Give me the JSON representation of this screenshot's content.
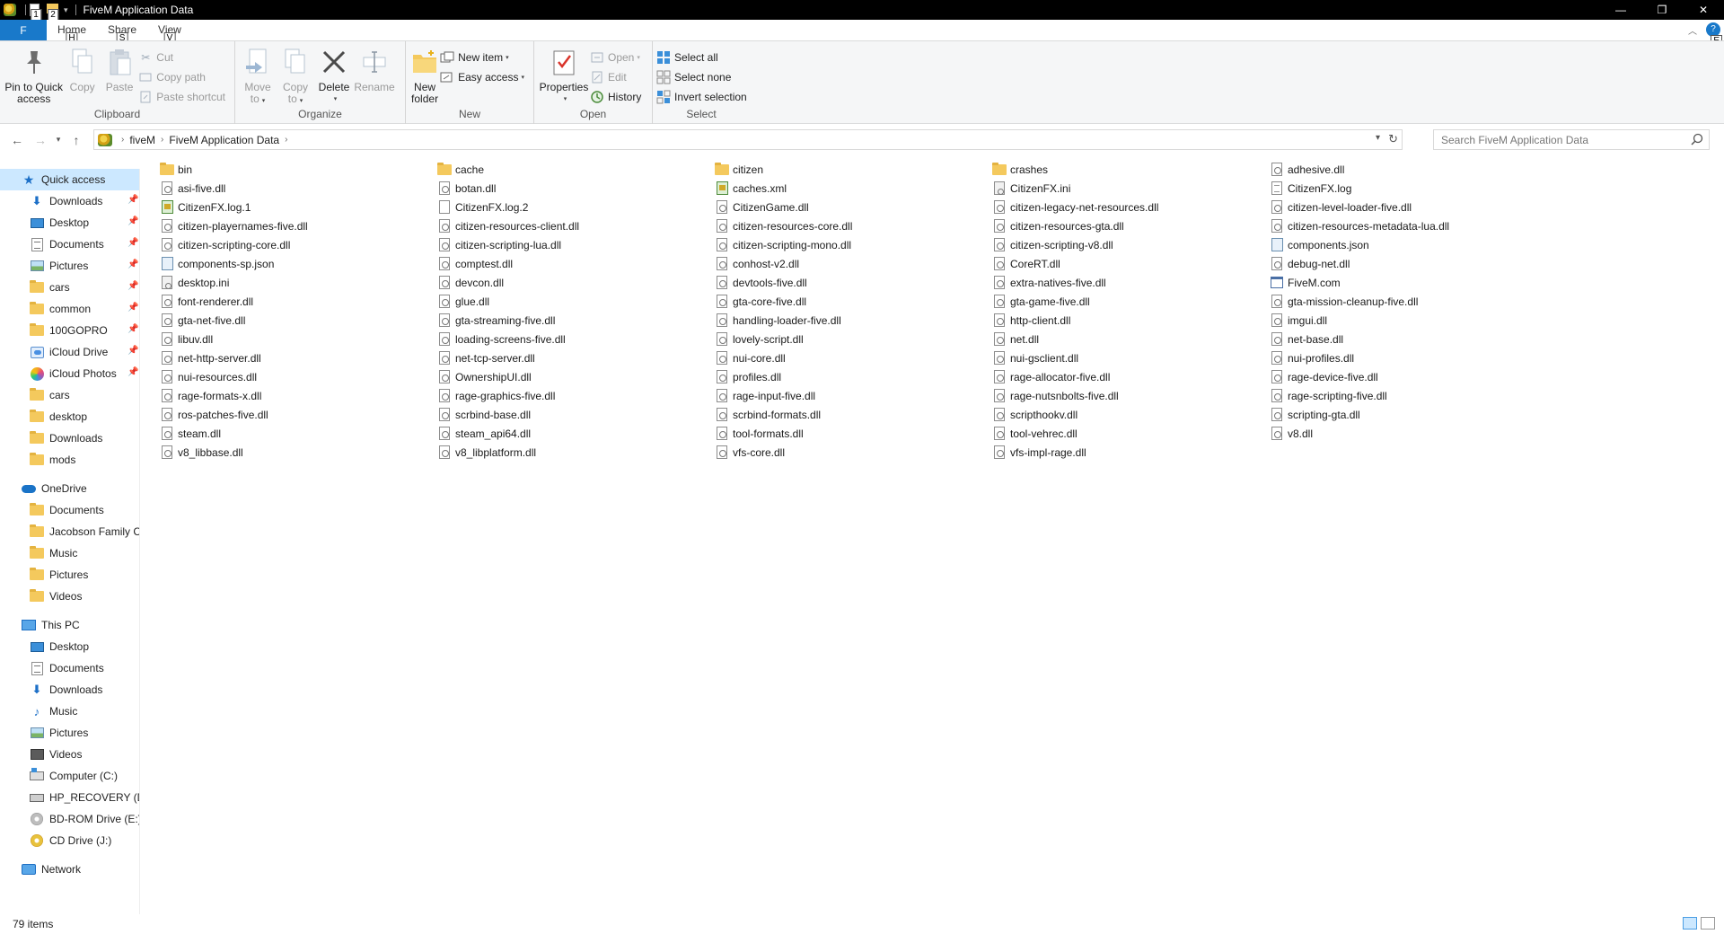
{
  "window": {
    "title": "FiveM Application Data",
    "controls": [
      "minimize",
      "maximize",
      "close"
    ]
  },
  "quick_access_toolbar": {
    "keytips": [
      "1",
      "2"
    ]
  },
  "ribbon_tabs": {
    "file": {
      "label": "F"
    },
    "tabs": [
      {
        "label": "Home",
        "keytip": "H"
      },
      {
        "label": "Share",
        "keytip": "S"
      },
      {
        "label": "View",
        "keytip": "V"
      }
    ],
    "help_keytip": "E"
  },
  "ribbon": {
    "clipboard": {
      "label": "Clipboard",
      "pin": "Pin to Quick access",
      "pin_line1": "Pin to Quick",
      "pin_line2": "access",
      "copy": "Copy",
      "paste": "Paste",
      "cut": "Cut",
      "copy_path": "Copy path",
      "paste_shortcut": "Paste shortcut"
    },
    "organize": {
      "label": "Organize",
      "move_to": "Move",
      "move_to2": "to",
      "copy_to": "Copy",
      "copy_to2": "to",
      "delete": "Delete",
      "rename": "Rename"
    },
    "new": {
      "label": "New",
      "new_folder1": "New",
      "new_folder2": "folder",
      "new_item": "New item",
      "easy_access": "Easy access"
    },
    "open": {
      "label": "Open",
      "properties": "Properties",
      "open": "Open",
      "edit": "Edit",
      "history": "History"
    },
    "select": {
      "label": "Select",
      "select_all": "Select all",
      "select_none": "Select none",
      "invert_selection": "Invert selection"
    }
  },
  "address": {
    "crumbs": [
      "fiveM",
      "FiveM Application Data"
    ],
    "search_placeholder": "Search FiveM Application Data"
  },
  "sidebar": {
    "quick_access": {
      "label": "Quick access"
    },
    "quick_items": [
      {
        "label": "Downloads",
        "icon": "download-icon",
        "pinned": true
      },
      {
        "label": "Desktop",
        "icon": "desktop-icon",
        "pinned": true
      },
      {
        "label": "Documents",
        "icon": "documents-icon",
        "pinned": true
      },
      {
        "label": "Pictures",
        "icon": "pictures-icon",
        "pinned": true
      },
      {
        "label": "cars",
        "icon": "folder-icon",
        "pinned": true
      },
      {
        "label": "common",
        "icon": "folder-icon",
        "pinned": true
      },
      {
        "label": "100GOPRO",
        "icon": "folder-icon",
        "pinned": true
      },
      {
        "label": "iCloud Drive",
        "icon": "icloud-drive-icon",
        "pinned": true
      },
      {
        "label": "iCloud Photos",
        "icon": "icloud-photos-icon",
        "pinned": true
      },
      {
        "label": "cars",
        "icon": "folder-icon",
        "pinned": false
      },
      {
        "label": "desktop",
        "icon": "folder-icon",
        "pinned": false
      },
      {
        "label": "Downloads",
        "icon": "folder-icon",
        "pinned": false
      },
      {
        "label": "mods",
        "icon": "folder-icon",
        "pinned": false
      }
    ],
    "onedrive": {
      "label": "OneDrive"
    },
    "onedrive_items": [
      {
        "label": "Documents",
        "icon": "folder-icon"
      },
      {
        "label": "Jacobson Family Cc",
        "icon": "folder-icon"
      },
      {
        "label": "Music",
        "icon": "folder-icon"
      },
      {
        "label": "Pictures",
        "icon": "folder-icon"
      },
      {
        "label": "Videos",
        "icon": "folder-icon"
      }
    ],
    "this_pc": {
      "label": "This PC"
    },
    "pc_items": [
      {
        "label": "Desktop",
        "icon": "desktop-icon"
      },
      {
        "label": "Documents",
        "icon": "documents-icon"
      },
      {
        "label": "Downloads",
        "icon": "download-icon"
      },
      {
        "label": "Music",
        "icon": "music-icon"
      },
      {
        "label": "Pictures",
        "icon": "pictures-icon"
      },
      {
        "label": "Videos",
        "icon": "videos-icon"
      },
      {
        "label": "Computer (C:)",
        "icon": "drive-c-icon"
      },
      {
        "label": "HP_RECOVERY (D:)",
        "icon": "drive-d-icon"
      },
      {
        "label": "BD-ROM Drive (E:) F",
        "icon": "bd-rom-icon"
      },
      {
        "label": "CD Drive (J:)",
        "icon": "cd-drive-icon"
      }
    ],
    "network": {
      "label": "Network"
    }
  },
  "files": [
    {
      "name": "bin",
      "type": "folder"
    },
    {
      "name": "cache",
      "type": "folder"
    },
    {
      "name": "citizen",
      "type": "folder"
    },
    {
      "name": "crashes",
      "type": "folder"
    },
    {
      "name": "adhesive.dll",
      "type": "dll"
    },
    {
      "name": "asi-five.dll",
      "type": "dll"
    },
    {
      "name": "botan.dll",
      "type": "dll"
    },
    {
      "name": "caches.xml",
      "type": "xml"
    },
    {
      "name": "CitizenFX.ini",
      "type": "ini"
    },
    {
      "name": "CitizenFX.log",
      "type": "log"
    },
    {
      "name": "CitizenFX.log.1",
      "type": "xml"
    },
    {
      "name": "CitizenFX.log.2",
      "type": "file"
    },
    {
      "name": "CitizenGame.dll",
      "type": "dll"
    },
    {
      "name": "citizen-legacy-net-resources.dll",
      "type": "dll"
    },
    {
      "name": "citizen-level-loader-five.dll",
      "type": "dll"
    },
    {
      "name": "citizen-playernames-five.dll",
      "type": "dll"
    },
    {
      "name": "citizen-resources-client.dll",
      "type": "dll"
    },
    {
      "name": "citizen-resources-core.dll",
      "type": "dll"
    },
    {
      "name": "citizen-resources-gta.dll",
      "type": "dll"
    },
    {
      "name": "citizen-resources-metadata-lua.dll",
      "type": "dll"
    },
    {
      "name": "citizen-scripting-core.dll",
      "type": "dll"
    },
    {
      "name": "citizen-scripting-lua.dll",
      "type": "dll"
    },
    {
      "name": "citizen-scripting-mono.dll",
      "type": "dll"
    },
    {
      "name": "citizen-scripting-v8.dll",
      "type": "dll"
    },
    {
      "name": "components.json",
      "type": "json"
    },
    {
      "name": "components-sp.json",
      "type": "json"
    },
    {
      "name": "comptest.dll",
      "type": "dll"
    },
    {
      "name": "conhost-v2.dll",
      "type": "dll"
    },
    {
      "name": "CoreRT.dll",
      "type": "dll"
    },
    {
      "name": "debug-net.dll",
      "type": "dll"
    },
    {
      "name": "desktop.ini",
      "type": "ini"
    },
    {
      "name": "devcon.dll",
      "type": "dll"
    },
    {
      "name": "devtools-five.dll",
      "type": "dll"
    },
    {
      "name": "extra-natives-five.dll",
      "type": "dll"
    },
    {
      "name": "FiveM.com",
      "type": "com"
    },
    {
      "name": "font-renderer.dll",
      "type": "dll"
    },
    {
      "name": "glue.dll",
      "type": "dll"
    },
    {
      "name": "gta-core-five.dll",
      "type": "dll"
    },
    {
      "name": "gta-game-five.dll",
      "type": "dll"
    },
    {
      "name": "gta-mission-cleanup-five.dll",
      "type": "dll"
    },
    {
      "name": "gta-net-five.dll",
      "type": "dll"
    },
    {
      "name": "gta-streaming-five.dll",
      "type": "dll"
    },
    {
      "name": "handling-loader-five.dll",
      "type": "dll"
    },
    {
      "name": "http-client.dll",
      "type": "dll"
    },
    {
      "name": "imgui.dll",
      "type": "dll"
    },
    {
      "name": "libuv.dll",
      "type": "dll"
    },
    {
      "name": "loading-screens-five.dll",
      "type": "dll"
    },
    {
      "name": "lovely-script.dll",
      "type": "dll"
    },
    {
      "name": "net.dll",
      "type": "dll"
    },
    {
      "name": "net-base.dll",
      "type": "dll"
    },
    {
      "name": "net-http-server.dll",
      "type": "dll"
    },
    {
      "name": "net-tcp-server.dll",
      "type": "dll"
    },
    {
      "name": "nui-core.dll",
      "type": "dll"
    },
    {
      "name": "nui-gsclient.dll",
      "type": "dll"
    },
    {
      "name": "nui-profiles.dll",
      "type": "dll"
    },
    {
      "name": "nui-resources.dll",
      "type": "dll"
    },
    {
      "name": "OwnershipUI.dll",
      "type": "dll"
    },
    {
      "name": "profiles.dll",
      "type": "dll"
    },
    {
      "name": "rage-allocator-five.dll",
      "type": "dll"
    },
    {
      "name": "rage-device-five.dll",
      "type": "dll"
    },
    {
      "name": "rage-formats-x.dll",
      "type": "dll"
    },
    {
      "name": "rage-graphics-five.dll",
      "type": "dll"
    },
    {
      "name": "rage-input-five.dll",
      "type": "dll"
    },
    {
      "name": "rage-nutsnbolts-five.dll",
      "type": "dll"
    },
    {
      "name": "rage-scripting-five.dll",
      "type": "dll"
    },
    {
      "name": "ros-patches-five.dll",
      "type": "dll"
    },
    {
      "name": "scrbind-base.dll",
      "type": "dll"
    },
    {
      "name": "scrbind-formats.dll",
      "type": "dll"
    },
    {
      "name": "scripthookv.dll",
      "type": "dll"
    },
    {
      "name": "scripting-gta.dll",
      "type": "dll"
    },
    {
      "name": "steam.dll",
      "type": "dll"
    },
    {
      "name": "steam_api64.dll",
      "type": "dll"
    },
    {
      "name": "tool-formats.dll",
      "type": "dll"
    },
    {
      "name": "tool-vehrec.dll",
      "type": "dll"
    },
    {
      "name": "v8.dll",
      "type": "dll"
    },
    {
      "name": "v8_libbase.dll",
      "type": "dll"
    },
    {
      "name": "v8_libplatform.dll",
      "type": "dll"
    },
    {
      "name": "vfs-core.dll",
      "type": "dll"
    },
    {
      "name": "vfs-impl-rage.dll",
      "type": "dll"
    }
  ],
  "status": {
    "item_count": "79 items"
  }
}
